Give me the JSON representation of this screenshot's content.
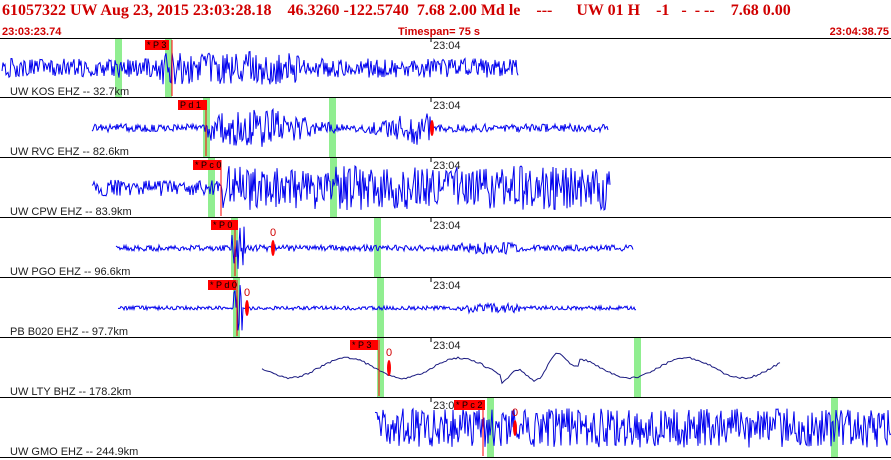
{
  "header": {
    "title": "61057322 UW Aug 23, 2015 23:03:28.18    46.3260 -122.5740  7.68 2.00 Md le    ---      UW 01 H    -1   -  - --    7.68 0.00",
    "time_start": "23:03:23.74",
    "timespan": "Timespan=  75 s",
    "time_end": "23:04:38.75"
  },
  "colors": {
    "trace": "#0000ee",
    "trace_lowgain": "#1a1a80",
    "pick": "#ff0000",
    "window_marker": "#90ee90",
    "header_text": "#d00000"
  },
  "minute_label": "23:04",
  "channels": [
    {
      "label": "UW KOS EHZ -- 32.7km",
      "pick": "* P 3",
      "zero": ""
    },
    {
      "label": "UW RVC EHZ -- 82.6km",
      "pick": "P d 1",
      "zero": ""
    },
    {
      "label": "UW CPW EHZ -- 83.9km",
      "pick": "* P c 0",
      "zero": ""
    },
    {
      "label": "UW PGO EHZ -- 96.6km",
      "pick": "* P 0",
      "zero": "0"
    },
    {
      "label": "PB B020 EHZ -- 97.7km",
      "pick": "* P d 0",
      "zero": "0"
    },
    {
      "label": "UW LTY BHZ -- 178.2km",
      "pick": "* P 3",
      "zero": "0"
    },
    {
      "label": "UW GMO EHZ -- 244.9km",
      "pick": "* P c 2",
      "zero": "0"
    }
  ]
}
